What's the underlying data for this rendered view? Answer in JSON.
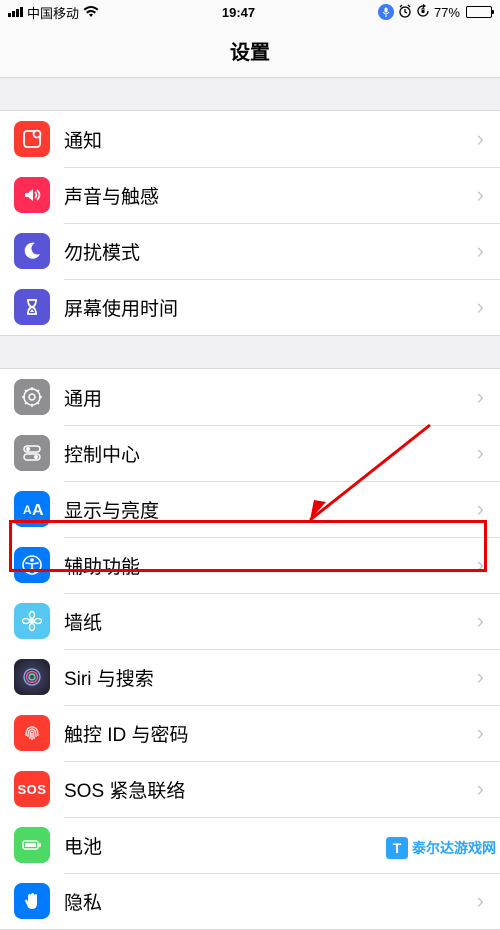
{
  "status": {
    "carrier": "中国移动",
    "time": "19:47",
    "battery_pct": "77%"
  },
  "header": {
    "title": "设置"
  },
  "groups": [
    {
      "rows": [
        {
          "id": "notifications",
          "label": "通知",
          "icon": "notifications-icon",
          "bg": "#ff3b30"
        },
        {
          "id": "sounds",
          "label": "声音与触感",
          "icon": "sounds-icon",
          "bg": "#ff2d55"
        },
        {
          "id": "dnd",
          "label": "勿扰模式",
          "icon": "moon-icon",
          "bg": "#5856d6"
        },
        {
          "id": "screentime",
          "label": "屏幕使用时间",
          "icon": "hourglass-icon",
          "bg": "#5856d6"
        }
      ]
    },
    {
      "rows": [
        {
          "id": "general",
          "label": "通用",
          "icon": "gear-icon",
          "bg": "#8e8e93"
        },
        {
          "id": "control-center",
          "label": "控制中心",
          "icon": "switches-icon",
          "bg": "#8e8e93"
        },
        {
          "id": "display",
          "label": "显示与亮度",
          "icon": "text-size-icon",
          "bg": "#007aff"
        },
        {
          "id": "accessibility",
          "label": "辅助功能",
          "icon": "accessibility-icon",
          "bg": "#007aff"
        },
        {
          "id": "wallpaper",
          "label": "墙纸",
          "icon": "flower-icon",
          "bg": "#54c8f0"
        },
        {
          "id": "siri",
          "label": "Siri 与搜索",
          "icon": "siri-icon",
          "bg": "#222"
        },
        {
          "id": "touchid",
          "label": "触控 ID 与密码",
          "icon": "fingerprint-icon",
          "bg": "#ff3b30"
        },
        {
          "id": "sos",
          "label": "SOS 紧急联络",
          "icon": "sos-icon",
          "bg": "#ff3b30"
        },
        {
          "id": "battery",
          "label": "电池",
          "icon": "battery-icon",
          "bg": "#4cd964"
        },
        {
          "id": "privacy",
          "label": "隐私",
          "icon": "hand-icon",
          "bg": "#007aff"
        }
      ]
    }
  ],
  "annotation": {
    "highlight_row_id": "accessibility"
  },
  "watermark": {
    "logo_letter": "T",
    "text": "泰尔达游戏网"
  }
}
